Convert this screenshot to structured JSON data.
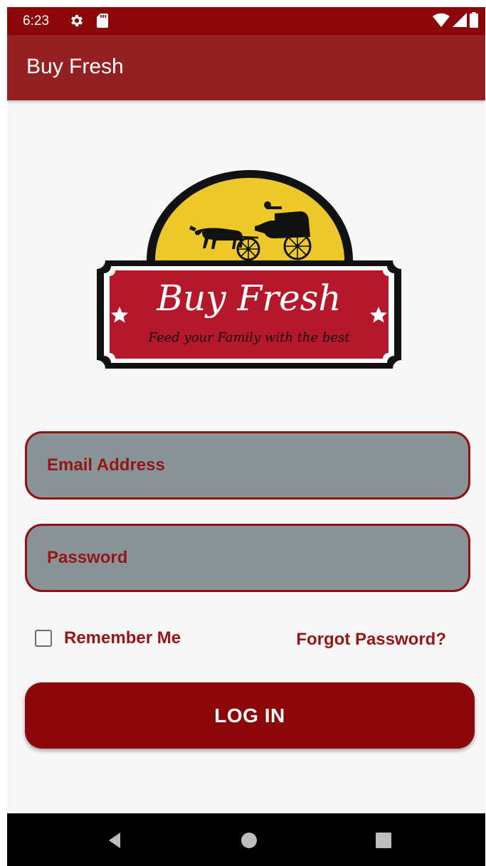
{
  "status_bar": {
    "time": "6:23",
    "icons_left": [
      "gear-icon",
      "sd-card-icon"
    ],
    "icons_right": [
      "wifi-icon",
      "signal-icon",
      "battery-icon"
    ]
  },
  "app_bar": {
    "title": "Buy Fresh"
  },
  "logo": {
    "brand": "Buy Fresh",
    "tagline": "Feed your Family with the best"
  },
  "form": {
    "email_placeholder": "Email Address",
    "email_value": "",
    "password_placeholder": "Password",
    "password_value": "",
    "remember_label": "Remember Me",
    "remember_checked": false,
    "forgot_label": "Forgot Password?",
    "login_label": "LOG IN"
  },
  "nav_bar": {
    "buttons": [
      "back-icon",
      "home-icon",
      "recents-icon"
    ]
  },
  "colors": {
    "status_bar": "#8b0709",
    "app_bar": "#942021",
    "accent": "#961516",
    "field_bg": "#889495",
    "logo_red": "#b5172b",
    "logo_yellow": "#ecc82a"
  }
}
